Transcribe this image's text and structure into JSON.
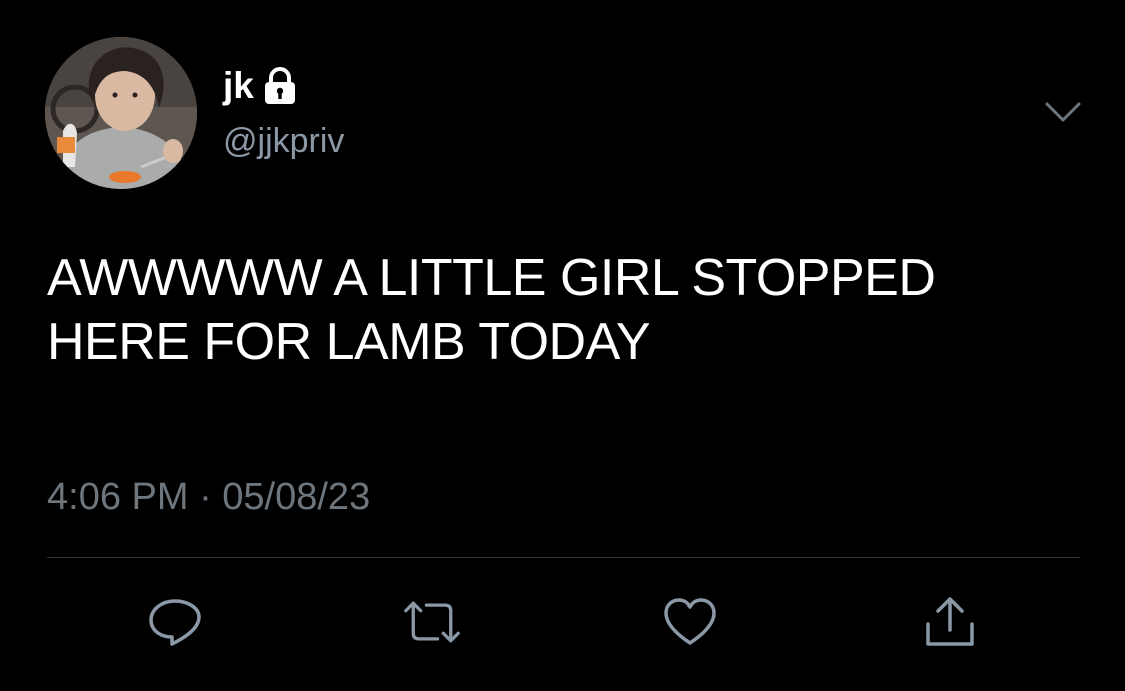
{
  "tweet": {
    "author": {
      "display_name": "jk",
      "handle": "@jjkpriv",
      "protected": true
    },
    "text": "AWWWWW A LITTLE GIRL STOPPED\nHERE FOR LAMB TODAY",
    "timestamp": "4:06 PM · 05/08/23"
  },
  "icons": {
    "lock": "lock-icon",
    "caret": "chevron-down-icon",
    "reply": "reply-icon",
    "retweet": "retweet-icon",
    "like": "heart-icon",
    "share": "share-icon"
  },
  "colors": {
    "background": "#000000",
    "primary_text": "#ffffff",
    "secondary_text": "#8b98a5",
    "timestamp_text": "#6e767d",
    "divider": "#2f3336",
    "icon": "#8b98a5"
  }
}
